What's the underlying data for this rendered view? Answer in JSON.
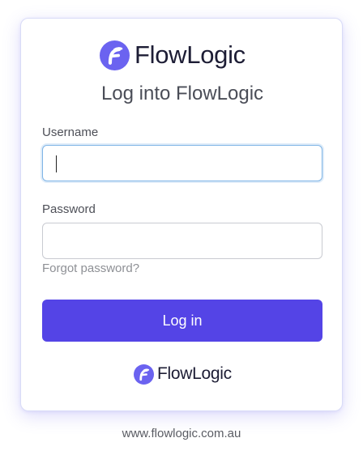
{
  "brand": {
    "name": "FlowLogic",
    "color": "#6b63f0"
  },
  "login": {
    "heading": "Log into FlowLogic",
    "username_label": "Username",
    "username_value": "",
    "password_label": "Password",
    "password_value": "",
    "forgot_link": "Forgot password?",
    "submit_label": "Log in",
    "button_color": "#5444e6"
  },
  "footer": {
    "url": "www.flowlogic.com.au"
  }
}
